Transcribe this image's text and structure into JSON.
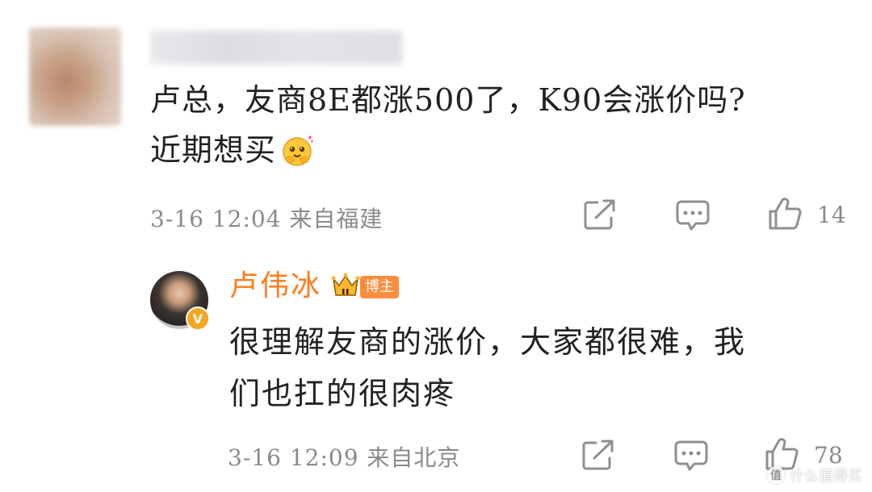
{
  "comment": {
    "text_line1": "卢总，友商8E都涨500了，K90会涨价吗?",
    "text_line2": "近期想买",
    "emoji": "hug-emoji",
    "date": "3-16",
    "time": "12:04",
    "location": "来自福建",
    "like_count": "14"
  },
  "reply": {
    "author": "卢伟冰",
    "badge": "博主",
    "verified_mark": "V",
    "text_line1": "很理解友商的涨价，大家都很难，我",
    "text_line2": "们也扛的很肉疼",
    "date": "3-16",
    "time": "12:09",
    "location": "来自北京",
    "like_count": "78"
  },
  "watermark": {
    "text": "什么值得买",
    "symbol": "值"
  },
  "colors": {
    "author_orange": "#ff7a1a",
    "badge_orange": "#ff8c3a",
    "meta_gray": "#8a8a8a",
    "verified_gold": "#f5a623"
  }
}
